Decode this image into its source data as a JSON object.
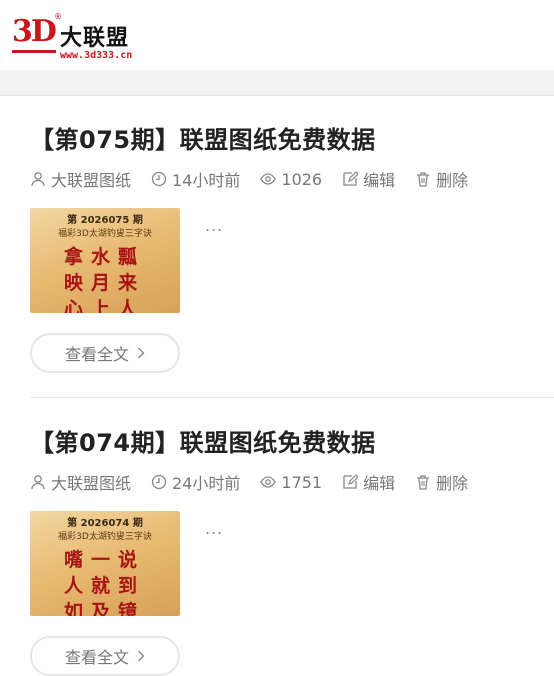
{
  "header": {
    "logo_mark": "3D",
    "logo_reg": "®",
    "logo_brand": "大联盟",
    "logo_url": "www.3d333.cn"
  },
  "posts": [
    {
      "title": "【第075期】联盟图纸免费数据",
      "author": "大联盟图纸",
      "time": "14小时前",
      "views": "1026",
      "edit": "编辑",
      "delete": "删除",
      "thumb_issue": "第 2026075 期",
      "thumb_sub": "福彩3D太湖钓叟三字诀",
      "thumb_line1": "拿水瓢",
      "thumb_line2": "映月来",
      "thumb_line3": "心上人",
      "excerpt": "...",
      "read_more": "查看全文"
    },
    {
      "title": "【第074期】联盟图纸免费数据",
      "author": "大联盟图纸",
      "time": "24小时前",
      "views": "1751",
      "edit": "编辑",
      "delete": "删除",
      "thumb_issue": "第 2026074 期",
      "thumb_sub": "福彩3D太湖钓叟三字诀",
      "thumb_line1": "嘴一说",
      "thumb_line2": "人就到",
      "thumb_line3": "如及镜",
      "excerpt": "...",
      "read_more": "查看全文"
    }
  ]
}
